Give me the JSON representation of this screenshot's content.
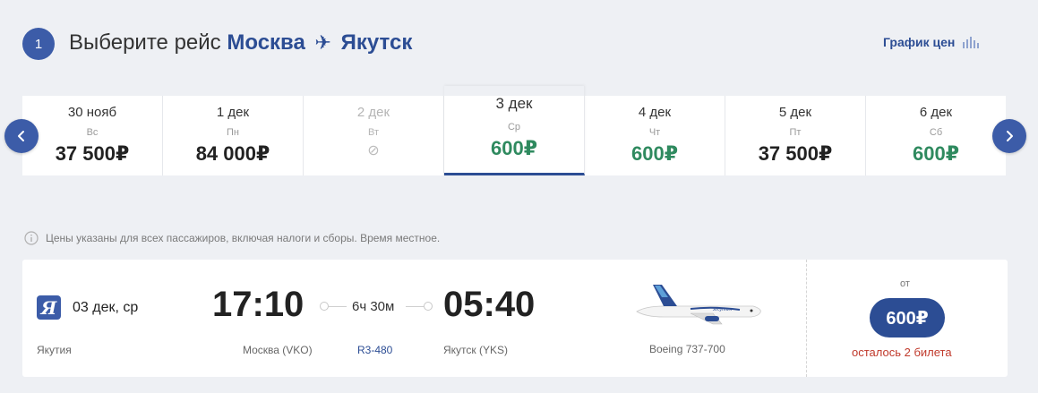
{
  "header": {
    "step": "1",
    "title_prefix": "Выберите рейс",
    "origin": "Москва",
    "destination": "Якутск",
    "price_graph_label": "График цен"
  },
  "dates": [
    {
      "date": "30 нояб",
      "weekday": "Вс",
      "price": "37 500₽",
      "state": "normal",
      "price_color": "dark"
    },
    {
      "date": "1 дек",
      "weekday": "Пн",
      "price": "84 000₽",
      "state": "normal",
      "price_color": "dark"
    },
    {
      "date": "2 дек",
      "weekday": "Вт",
      "price": "",
      "state": "disabled",
      "price_color": "none"
    },
    {
      "date": "3 дек",
      "weekday": "Ср",
      "price": "600₽",
      "state": "active",
      "price_color": "green"
    },
    {
      "date": "4 дек",
      "weekday": "Чт",
      "price": "600₽",
      "state": "normal",
      "price_color": "green"
    },
    {
      "date": "5 дек",
      "weekday": "Пт",
      "price": "37 500₽",
      "state": "normal",
      "price_color": "dark"
    },
    {
      "date": "6 дек",
      "weekday": "Сб",
      "price": "600₽",
      "state": "normal",
      "price_color": "green"
    }
  ],
  "note": "Цены указаны для всех пассажиров, включая налоги и сборы. Время местное.",
  "flight": {
    "airline_logo_letter": "Я",
    "date": "03 дек, ср",
    "airline": "Якутия",
    "departure_time": "17:10",
    "departure_airport": "Москва (VKO)",
    "duration": "6ч 30м",
    "flight_number": "R3-480",
    "arrival_time": "05:40",
    "arrival_airport": "Якутск (YKS)",
    "aircraft": "Boeing 737-700",
    "from_label": "от",
    "price": "600₽",
    "tickets_left": "осталось 2 билета"
  },
  "colors": {
    "accent": "#2c4d94",
    "badge": "#3c5ca8",
    "green_price": "#2f8a5f",
    "warning": "#c0392b",
    "background": "#eef0f4"
  },
  "icons": {
    "prev": "chevron-left-icon",
    "next": "chevron-right-icon",
    "graph": "bar-chart-icon",
    "info": "info-icon",
    "plane": "airplane-icon",
    "unavailable": "no-flights-icon"
  }
}
